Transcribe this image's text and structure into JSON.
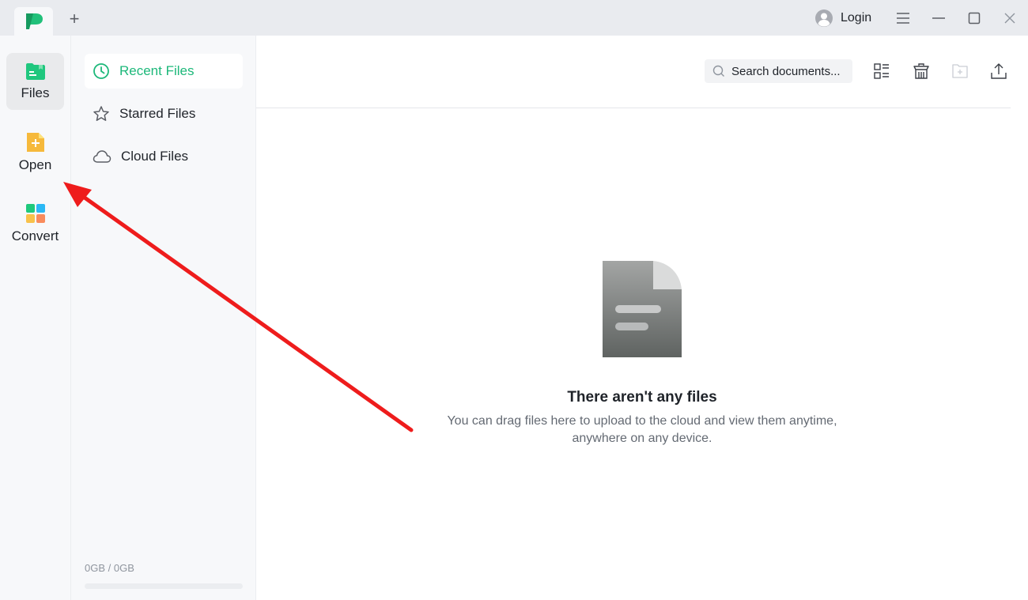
{
  "titlebar": {
    "tab_icon": "app-logo-icon",
    "new_tab_label": "+",
    "login_label": "Login",
    "icons": [
      "user-avatar-icon",
      "menu-icon",
      "minimize-icon",
      "maximize-icon",
      "close-icon"
    ]
  },
  "rail": {
    "items": [
      {
        "label": "Files",
        "icon": "files-folder-icon",
        "active": true
      },
      {
        "label": "Open",
        "icon": "open-file-icon",
        "active": false
      },
      {
        "label": "Convert",
        "icon": "convert-grid-icon",
        "active": false
      }
    ]
  },
  "sidebar": {
    "items": [
      {
        "label": "Recent Files",
        "icon": "clock-icon",
        "active": true
      },
      {
        "label": "Starred Files",
        "icon": "star-icon",
        "active": false
      },
      {
        "label": "Cloud Files",
        "icon": "cloud-icon",
        "active": false
      }
    ],
    "storage": {
      "text": "0GB / 0GB",
      "used_fraction": 0
    }
  },
  "toolbar": {
    "search_placeholder": "Search documents...",
    "search_value": "",
    "icons": [
      "view-toggle-icon",
      "trash-icon",
      "new-folder-icon",
      "upload-icon"
    ]
  },
  "empty_state": {
    "title": "There aren't any files",
    "description_line1": "You can drag files here to upload to the cloud and view them anytime,",
    "description_line2": "anywhere on any device."
  },
  "colors": {
    "accent": "#1db87a",
    "annotation_arrow": "#ee1c1c"
  }
}
